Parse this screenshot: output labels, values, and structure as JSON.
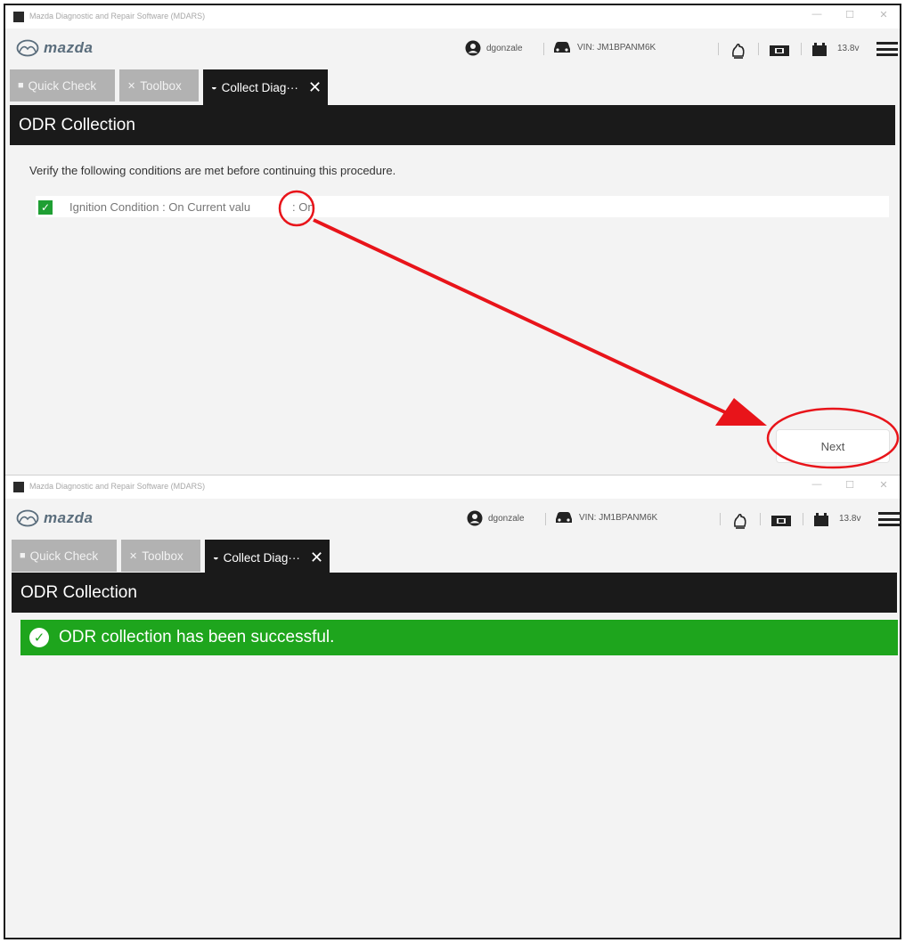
{
  "window": {
    "title": "Mazda Diagnostic and Repair Software (MDARS)",
    "controls": {
      "minimize": "—",
      "maximize": "☐",
      "close": "✕"
    }
  },
  "header": {
    "brand": "mazda",
    "user": "dgonzale",
    "vin": "VIN: JM1BPANM6K",
    "voltage": "13.8v",
    "icons": [
      "user-icon",
      "car-icon",
      "hand-icon",
      "ticket-icon",
      "battery-icon",
      "menu-icon"
    ]
  },
  "tabs": [
    {
      "label": "Quick Check",
      "icon": "briefcase-icon",
      "active": false
    },
    {
      "label": "Toolbox",
      "icon": "tools-icon",
      "active": false
    },
    {
      "label": "Collect Diag···",
      "icon": "car-gauge-icon",
      "active": true
    }
  ],
  "screen1": {
    "page_title": "ODR Collection",
    "instruction": "Verify the following conditions are met before continuing this procedure.",
    "condition": {
      "checked": true,
      "label": "Ignition Condition : On Current valu",
      "value": ": On"
    },
    "next_button": "Next",
    "annotation_color": "#e8141a"
  },
  "screen2": {
    "page_title": "ODR Collection",
    "success_message": "ODR collection has been successful.",
    "success_color": "#1ea51d"
  }
}
